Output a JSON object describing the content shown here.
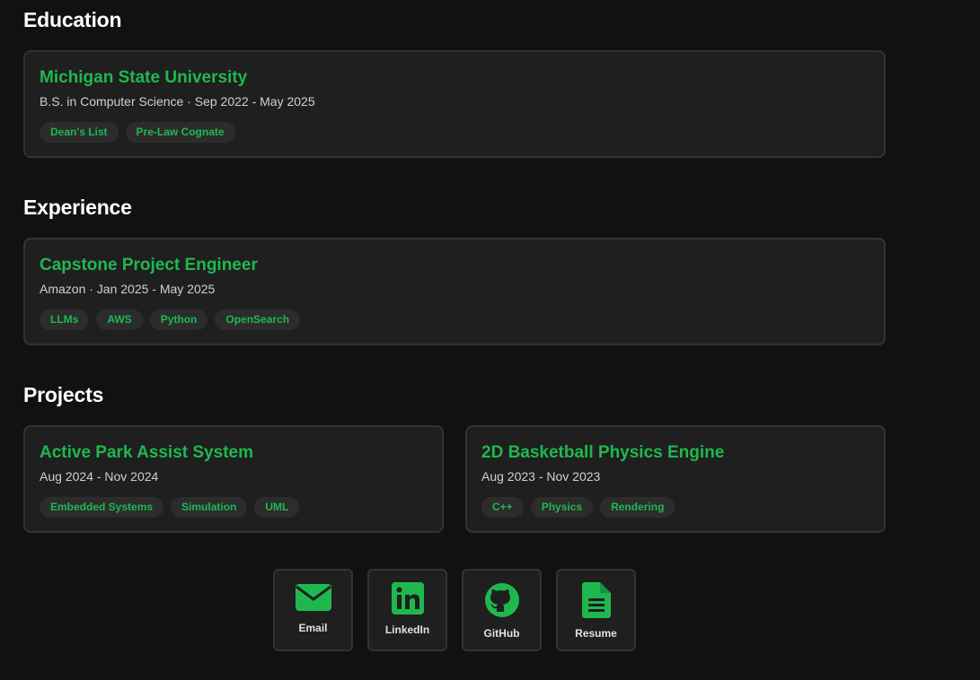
{
  "education": {
    "title": "Education",
    "card": {
      "name": "Michigan State University",
      "subtitle": "B.S. in Computer Science · Sep 2022 - May 2025",
      "tags": [
        "Dean's List",
        "Pre-Law Cognate"
      ]
    }
  },
  "experience": {
    "title": "Experience",
    "card": {
      "name": "Capstone Project Engineer",
      "subtitle": "Amazon · Jan 2025 - May 2025",
      "tags": [
        "LLMs",
        "AWS",
        "Python",
        "OpenSearch"
      ]
    }
  },
  "projects": {
    "title": "Projects",
    "items": [
      {
        "name": "Active Park Assist System",
        "subtitle": "Aug 2024 - Nov 2024",
        "tags": [
          "Embedded Systems",
          "Simulation",
          "UML"
        ]
      },
      {
        "name": "2D Basketball Physics Engine",
        "subtitle": "Aug 2023 - Nov 2023",
        "tags": [
          "C++",
          "Physics",
          "Rendering"
        ]
      }
    ]
  },
  "links": [
    {
      "label": "Email",
      "icon": "envelope-icon"
    },
    {
      "label": "LinkedIn",
      "icon": "linkedin-icon"
    },
    {
      "label": "GitHub",
      "icon": "github-icon"
    },
    {
      "label": "Resume",
      "icon": "document-icon"
    }
  ],
  "colors": {
    "accent": "#1fb84f",
    "background": "#111111",
    "card": "#1f1f1f",
    "border": "#333333",
    "tag_bg": "#2c2c2c"
  }
}
